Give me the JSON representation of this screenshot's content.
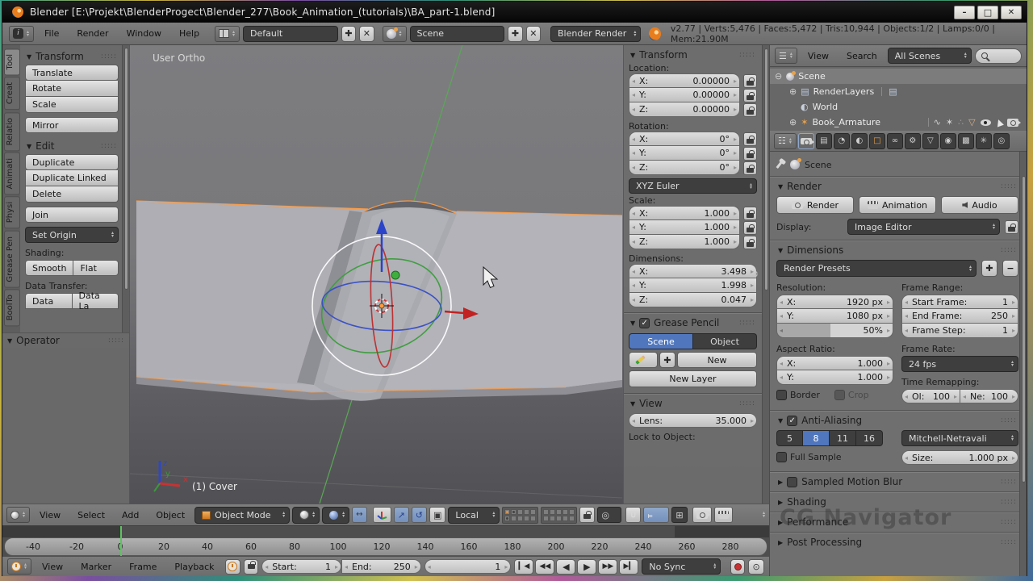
{
  "window": {
    "title": "Blender [E:\\Projekt\\BlenderProgect\\Blender_277\\Book_Animation_(tutorials)\\BA_part-1.blend]"
  },
  "infobar": {
    "menus": [
      "File",
      "Render",
      "Window",
      "Help"
    ],
    "layout": "Default",
    "scene": "Scene",
    "engine": "Blender Render",
    "stats": "v2.77 | Verts:5,476 | Faces:5,472 | Tris:10,944 | Objects:1/2 | Lamps:0/0 | Mem:21.90M"
  },
  "toolshelf": {
    "tabs": [
      "Tool",
      "Creat",
      "Relatio",
      "Animati",
      "Physi",
      "Grease Pen",
      "BoolTo"
    ],
    "transform": {
      "title": "Transform",
      "b1": "Translate",
      "b2": "Rotate",
      "b3": "Scale",
      "b4": "Mirror"
    },
    "edit": {
      "title": "Edit",
      "b1": "Duplicate",
      "b2": "Duplicate Linked",
      "b3": "Delete",
      "b4": "Join",
      "set_origin": "Set Origin"
    },
    "shading": {
      "label": "Shading:",
      "smooth": "Smooth",
      "flat": "Flat"
    },
    "data_transfer": {
      "label": "Data Transfer:",
      "data": "Data",
      "data_layout": "Data La"
    },
    "operator": {
      "title": "Operator"
    }
  },
  "viewport": {
    "view_label": "User Ortho",
    "object_label": "(1) Cover",
    "axis_x": "x",
    "axis_y": "y",
    "axis_z": "z",
    "header": {
      "menus": [
        "View",
        "Select",
        "Add",
        "Object"
      ],
      "mode": "Object Mode",
      "orientation": "Local"
    }
  },
  "npanel": {
    "transform": {
      "title": "Transform",
      "location_label": "Location:",
      "loc": [
        {
          "l": "X:",
          "v": "0.00000"
        },
        {
          "l": "Y:",
          "v": "0.00000"
        },
        {
          "l": "Z:",
          "v": "0.00000"
        }
      ],
      "rotation_label": "Rotation:",
      "rot": [
        {
          "l": "X:",
          "v": "0°"
        },
        {
          "l": "Y:",
          "v": "0°"
        },
        {
          "l": "Z:",
          "v": "0°"
        }
      ],
      "euler": "XYZ Euler",
      "scale_label": "Scale:",
      "scl": [
        {
          "l": "X:",
          "v": "1.000"
        },
        {
          "l": "Y:",
          "v": "1.000"
        },
        {
          "l": "Z:",
          "v": "1.000"
        }
      ],
      "dimensions_label": "Dimensions:",
      "dim": [
        {
          "l": "X:",
          "v": "3.498"
        },
        {
          "l": "Y:",
          "v": "1.998"
        },
        {
          "l": "Z:",
          "v": "0.047"
        }
      ]
    },
    "grease": {
      "title": "Grease Pencil",
      "scene": "Scene",
      "object": "Object",
      "new": "New",
      "new_layer": "New Layer"
    },
    "view": {
      "title": "View",
      "lens_label": "Lens:",
      "lens_value": "35.000",
      "lock_label": "Lock to Object:"
    }
  },
  "outliner": {
    "menus": [
      "View",
      "Search"
    ],
    "scope": "All Scenes",
    "scene": "Scene",
    "renderlayers": "RenderLayers",
    "world": "World",
    "armature": "Book_Armature"
  },
  "properties": {
    "breadcrumb": "Scene",
    "render": {
      "title": "Render",
      "render": "Render",
      "animation": "Animation",
      "audio": "Audio",
      "display_label": "Display:",
      "display": "Image Editor"
    },
    "dimensions": {
      "title": "Dimensions",
      "presets": "Render Presets",
      "resolution_label": "Resolution:",
      "rx_l": "X:",
      "rx_v": "1920 px",
      "ry_l": "Y:",
      "ry_v": "1080 px",
      "pct": "50%",
      "frame_range_label": "Frame Range:",
      "sf_l": "Start Frame:",
      "sf_v": "1",
      "ef_l": "End Frame:",
      "ef_v": "250",
      "fs_l": "Frame Step:",
      "fs_v": "1",
      "aspect_label": "Aspect Ratio:",
      "ax_l": "X:",
      "ax_v": "1.000",
      "ay_l": "Y:",
      "ay_v": "1.000",
      "border": "Border",
      "crop": "Crop",
      "framerate_label": "Frame Rate:",
      "framerate": "24 fps",
      "remap_label": "Time Remapping:",
      "old_l": "Ol:",
      "old_v": "100",
      "new_l": "Ne:",
      "new_v": "100"
    },
    "aa": {
      "title": "Anti-Aliasing",
      "s1": "5",
      "s2": "8",
      "s3": "11",
      "s4": "16",
      "filter": "Mitchell-Netravali",
      "full_sample": "Full Sample",
      "size_l": "Size:",
      "size_v": "1.000 px"
    },
    "motion_blur": "Sampled Motion Blur",
    "shading": "Shading",
    "performance": "Performance",
    "post": "Post Processing",
    "watermark": "CG Navigator"
  },
  "timeline": {
    "menus": [
      "View",
      "Marker",
      "Frame",
      "Playback"
    ],
    "start_l": "Start:",
    "start_v": "1",
    "end_l": "End:",
    "end_v": "250",
    "frame": "1",
    "sync": "No Sync",
    "ticks": [
      "-40",
      "-20",
      "0",
      "20",
      "40",
      "60",
      "80",
      "100",
      "120",
      "140",
      "160",
      "180",
      "200",
      "220",
      "240",
      "260",
      "280"
    ]
  },
  "colors": {
    "accent_blue": "#5077be",
    "select_orange": "#ff9c42",
    "playhead_green": "#5fc25f"
  }
}
